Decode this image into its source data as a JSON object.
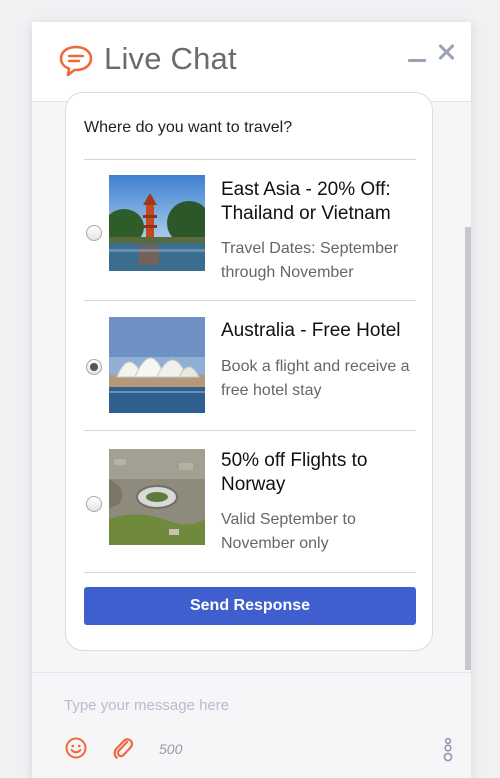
{
  "header": {
    "title": "Live Chat",
    "logo_icon": "chat-bubble-icon",
    "accent": "#ee6a3d"
  },
  "survey": {
    "question": "Where do you want to travel?",
    "options": [
      {
        "title": "East Asia - 20% Off: Thailand or Vietnam",
        "description": "Travel Dates: September through November",
        "selected": false,
        "image": "pagoda-photo"
      },
      {
        "title": "Australia - Free Hotel",
        "description": "Book a flight and receive a free hotel stay",
        "selected": true,
        "image": "opera-house-photo"
      },
      {
        "title": "50% off Flights to Norway",
        "description": "Valid September to November only",
        "selected": false,
        "image": "stadium-aerial-photo"
      }
    ],
    "send_label": "Send Response",
    "send_color": "#3f5fcf"
  },
  "composer": {
    "placeholder": "Type your message here",
    "char_limit": "500"
  }
}
